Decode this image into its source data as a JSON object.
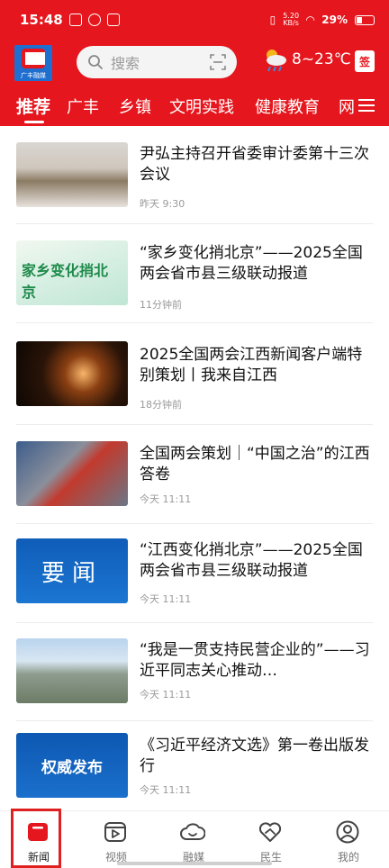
{
  "status": {
    "time": "15:48",
    "net_speed_value": "5.20",
    "net_speed_unit": "KB/s",
    "battery": "29%"
  },
  "header": {
    "logo_text": "广丰融媒",
    "search_placeholder": "搜索",
    "weather": "8~23℃",
    "sign_label": "签"
  },
  "tabs": [
    "推荐",
    "广丰",
    "乡镇",
    "文明实践",
    "健康教育",
    "网"
  ],
  "articles": [
    {
      "title": "尹弘主持召开省委审计委第十三次会议",
      "time": "昨天 9:30"
    },
    {
      "title": "“家乡变化捎北京”——2025全国两会省市县三级联动报道",
      "time": "11分钟前"
    },
    {
      "title": "2025全国两会江西新闻客户端特别策划丨我来自江西",
      "time": "18分钟前"
    },
    {
      "title": "全国两会策划｜“中国之治”的江西答卷",
      "time": "今天 11:11"
    },
    {
      "title": "“江西变化捎北京”——2025全国两会省市县三级联动报道",
      "time": "今天 11:11"
    },
    {
      "title": "“我是一贯支持民营企业的”——习近平同志关心推动…",
      "time": "今天 11:11"
    },
    {
      "title": "《习近平经济文选》第一卷出版发行",
      "time": "今天 11:11"
    }
  ],
  "thumbs": {
    "t2": "家乡变化捎北京",
    "t5": "要闻",
    "t7": "权威发布"
  },
  "bottom_nav": [
    "新闻",
    "视频",
    "融媒",
    "民生",
    "我的"
  ],
  "colors": {
    "brand": "#e5161d",
    "nav_active": "#e5161d"
  }
}
